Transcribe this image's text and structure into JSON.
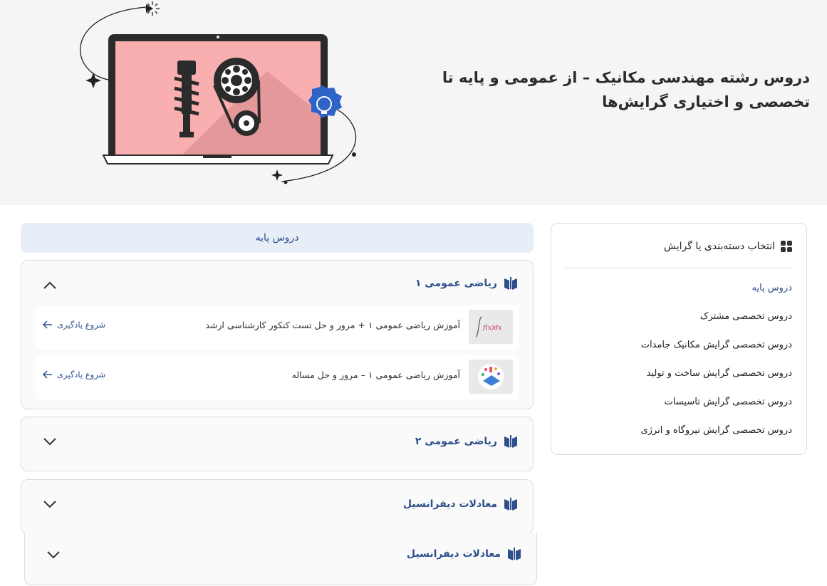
{
  "hero": {
    "title": "دروس رشته مهندسی مکانیک – از عمومی و پایه تا تخصصی و اختیاری گرایش‌ها"
  },
  "sidebar": {
    "title": "انتخاب دسته‌بندی یا گرایش",
    "items": [
      {
        "label": "دروس پایه",
        "active": true
      },
      {
        "label": "دروس تخصصی مشترک",
        "active": false
      },
      {
        "label": "دروس تخصصی گرایش مکانیک جامدات",
        "active": false
      },
      {
        "label": "دروس تخصصی گرایش ساخت و تولید",
        "active": false
      },
      {
        "label": "دروس تخصصی گرایش تاسیسات",
        "active": false
      },
      {
        "label": "دروس تخصصی گرایش نیروگاه و انرژی",
        "active": false
      }
    ]
  },
  "main": {
    "section_label": "دروس پایه",
    "accordions": [
      {
        "title": "ریاضی عمومی ۱",
        "expanded": true,
        "courses": [
          {
            "title": "آموزش ریاضی عمومی ۱ + مرور و حل تست کنکور کارشناسی ارشد",
            "cta": "شروع یادگیری",
            "thumb_text": "f(x)dx"
          },
          {
            "title": "آموزش ریاضی عمومی ۱ – مرور و حل مساله",
            "cta": "شروع یادگیری"
          }
        ]
      },
      {
        "title": "ریاضی عمومی ۲",
        "expanded": false
      },
      {
        "title": "معادلات دیفرانسیل",
        "expanded": false
      },
      {
        "title": "معادلات دیفرانسیل",
        "expanded": false
      }
    ]
  },
  "colors": {
    "accent": "#2d4f8c",
    "section_bg": "#e8eef7",
    "hero_bg": "#f5f5f5",
    "screen_pink": "#f9aeb0"
  },
  "icons": {
    "sidebar": "grid-icon",
    "accordion": "book-icon",
    "expand": "chevron-down-icon",
    "collapse": "chevron-up-icon",
    "cta": "arrow-left-icon"
  }
}
